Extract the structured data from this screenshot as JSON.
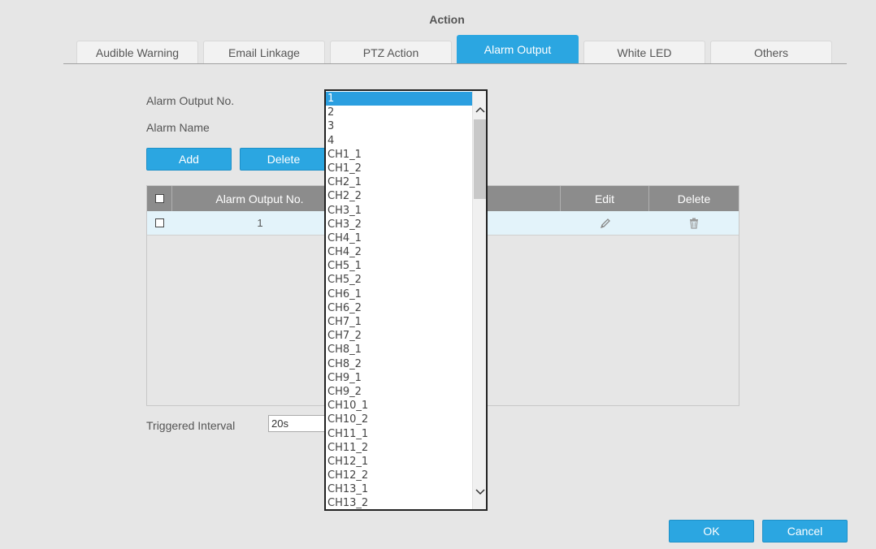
{
  "page": {
    "title": "Action"
  },
  "tabs": [
    {
      "label": "Audible Warning"
    },
    {
      "label": "Email Linkage"
    },
    {
      "label": "PTZ Action"
    },
    {
      "label": "Alarm Output",
      "active": true
    },
    {
      "label": "White LED"
    },
    {
      "label": "Others"
    }
  ],
  "form": {
    "alarm_output_no_label": "Alarm Output No.",
    "alarm_name_label": "Alarm Name",
    "add_label": "Add",
    "delete_label": "Delete",
    "triggered_interval_label": "Triggered Interval",
    "triggered_interval_value": "20s"
  },
  "table": {
    "headers": {
      "number": "Alarm Output No.",
      "edit": "Edit",
      "delete": "Delete"
    },
    "rows": [
      {
        "number": "1"
      }
    ]
  },
  "dropdown": {
    "selected": "1",
    "options": [
      "1",
      "2",
      "3",
      "4",
      "CH1_1",
      "CH1_2",
      "CH2_1",
      "CH2_2",
      "CH3_1",
      "CH3_2",
      "CH4_1",
      "CH4_2",
      "CH5_1",
      "CH5_2",
      "CH6_1",
      "CH6_2",
      "CH7_1",
      "CH7_2",
      "CH8_1",
      "CH8_2",
      "CH9_1",
      "CH9_2",
      "CH10_1",
      "CH10_2",
      "CH11_1",
      "CH11_2",
      "CH12_1",
      "CH12_2",
      "CH13_1",
      "CH13_2"
    ]
  },
  "footer": {
    "ok_label": "OK",
    "cancel_label": "Cancel"
  },
  "colors": {
    "accent": "#2ba6e1",
    "header_gray": "#8c8c8c",
    "row_highlight": "#e3f3fa",
    "background": "#e6e6e6"
  },
  "icons": {
    "edit": "pencil-icon",
    "delete": "trash-icon",
    "scroll_up": "chevron-up-icon",
    "scroll_down": "chevron-down-icon"
  }
}
